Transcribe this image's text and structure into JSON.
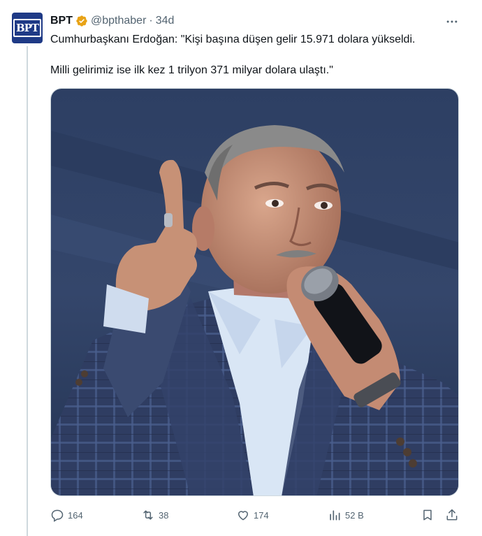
{
  "account": {
    "display_name": "BPT",
    "avatar_text": "BPT",
    "verified": true,
    "verified_icon": "verified-badge-gold",
    "handle": "@bpthaber",
    "separator": "·",
    "time": "34d"
  },
  "post": {
    "text_lines": [
      "Cumhurbaşkanı Erdoğan: \"Kişi başına düşen gelir 15.971 dolara yükseldi.",
      "Milli gelirimiz ise ilk kez 1 trilyon 371 milyar dolara ulaştı.\""
    ],
    "media": {
      "kind": "photo"
    }
  },
  "more_icon": "more-horizontal-icon",
  "actions": {
    "replies": "164",
    "reposts": "38",
    "likes": "174",
    "views": "52 B"
  },
  "colors": {
    "text_primary": "#0f1419",
    "text_secondary": "#536471",
    "verified_gold": "#e8a317",
    "avatar_bg": "#1f3a86",
    "thread_line": "#cfd9de"
  }
}
